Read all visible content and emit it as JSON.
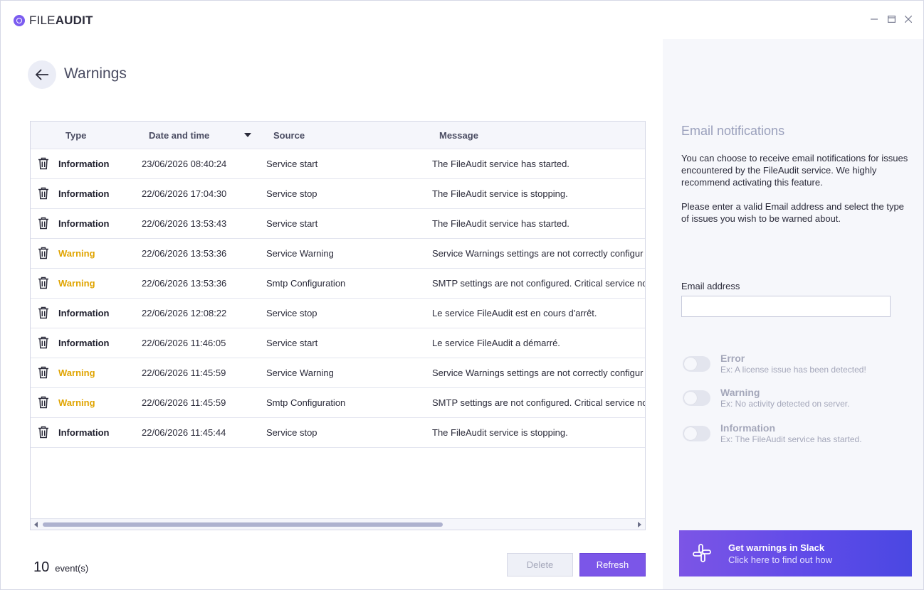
{
  "app": {
    "logo_prefix": "FILE",
    "logo_suffix": "AUDIT",
    "window_controls": [
      "minimize-icon",
      "maximize-icon",
      "close-icon"
    ]
  },
  "header": {
    "title": "Warnings"
  },
  "table": {
    "columns": {
      "type": "Type",
      "date": "Date and time",
      "source": "Source",
      "message": "Message"
    },
    "sort": {
      "column": "Date and time",
      "direction": "descending"
    },
    "rows": [
      {
        "type": "Information",
        "date": "23/06/2026 08:40:24",
        "source": "Service start",
        "message": "The FileAudit service has started."
      },
      {
        "type": "Information",
        "date": "22/06/2026 17:04:30",
        "source": "Service stop",
        "message": "The FileAudit service is stopping."
      },
      {
        "type": "Information",
        "date": "22/06/2026 13:53:43",
        "source": "Service start",
        "message": "The FileAudit service has started."
      },
      {
        "type": "Warning",
        "date": "22/06/2026 13:53:36",
        "source": "Service Warning",
        "message": "Service Warnings settings are not correctly configur"
      },
      {
        "type": "Warning",
        "date": "22/06/2026 13:53:36",
        "source": "Smtp Configuration",
        "message": "SMTP settings are not configured. Critical service no"
      },
      {
        "type": "Information",
        "date": "22/06/2026 12:08:22",
        "source": "Service stop",
        "message": "Le service FileAudit est en cours d'arrêt."
      },
      {
        "type": "Information",
        "date": "22/06/2026 11:46:05",
        "source": "Service start",
        "message": "Le service FileAudit a démarré."
      },
      {
        "type": "Warning",
        "date": "22/06/2026 11:45:59",
        "source": "Service Warning",
        "message": "Service Warnings settings are not correctly configur"
      },
      {
        "type": "Warning",
        "date": "22/06/2026 11:45:59",
        "source": "Smtp Configuration",
        "message": "SMTP settings are not configured. Critical service no"
      },
      {
        "type": "Information",
        "date": "22/06/2026 11:45:44",
        "source": "Service stop",
        "message": "The FileAudit service is stopping."
      }
    ]
  },
  "footer": {
    "event_count": "10",
    "event_label": "event(s)",
    "delete_label": "Delete",
    "refresh_label": "Refresh"
  },
  "notifications": {
    "title": "Email notifications",
    "paragraph1": "You can choose to receive email notifications for issues encountered by the FileAudit service. We highly recommend activating this feature.",
    "paragraph2": "Please enter a valid Email address and select the type of issues you wish to be warned about.",
    "email_label": "Email address",
    "email_value": "",
    "toggles": [
      {
        "title": "Error",
        "example": "Ex: A license issue has been detected!",
        "enabled": false
      },
      {
        "title": "Warning",
        "example": "Ex: No activity detected on server.",
        "enabled": false
      },
      {
        "title": "Information",
        "example": "Ex: The FileAudit service has started.",
        "enabled": false
      }
    ]
  },
  "slack": {
    "title": "Get warnings in Slack",
    "subtitle": "Click here to find out how"
  },
  "colors": {
    "accent": "#7b56e8",
    "warning": "#e0a400",
    "slack_gradient_start": "#7c55e6",
    "slack_gradient_end": "#4a48e2"
  }
}
